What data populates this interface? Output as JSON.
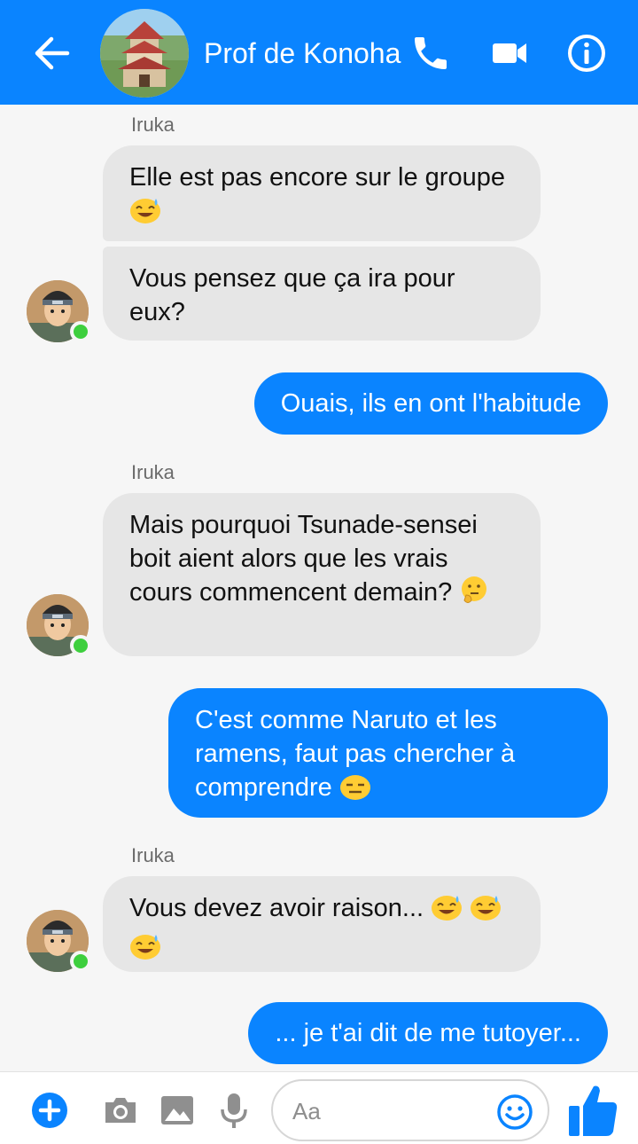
{
  "header": {
    "title": "Prof de Konoha",
    "accent": "#0a84ff",
    "icons": [
      "back-arrow-icon",
      "phone-icon",
      "video-camera-icon",
      "info-icon"
    ]
  },
  "messages": [
    {
      "sender": "Iruka",
      "direction": "in",
      "text": "Elle est pas encore sur le groupe",
      "emoji": "😅"
    },
    {
      "direction": "in",
      "text": "Vous pensez que ça ira pour eux?"
    },
    {
      "direction": "out",
      "text": "Ouais, ils en ont l'habitude"
    },
    {
      "sender": "Iruka",
      "direction": "in",
      "text": "Mais pourquoi Tsunade-sensei boit aient alors que les vrais cours commencent demain?",
      "emoji": "🤔"
    },
    {
      "direction": "out",
      "text": "C'est comme Naruto et les ramens, faut pas chercher à comprendre",
      "emoji": "😑"
    },
    {
      "sender": "Iruka",
      "direction": "in",
      "text": "Vous devez avoir raison...",
      "emoji": "😅😅😅"
    },
    {
      "direction": "out",
      "text": "... je t'ai dit de me tutoyer..."
    }
  ],
  "composer": {
    "placeholder": "Aa",
    "icons": [
      "add-icon",
      "camera-icon",
      "gallery-icon",
      "microphone-icon",
      "emoji-icon",
      "thumbs-up-icon"
    ]
  }
}
